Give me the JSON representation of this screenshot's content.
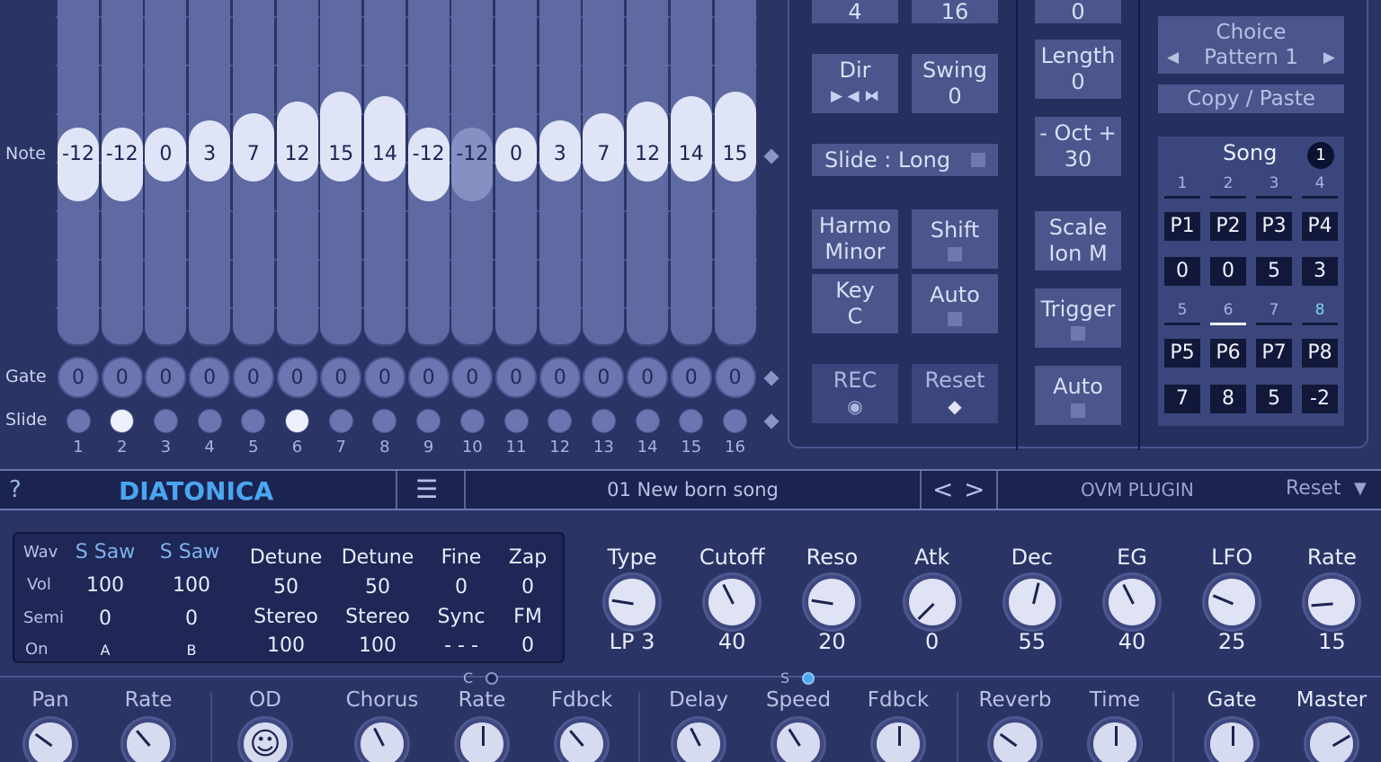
{
  "sequencer": {
    "row_labels": {
      "note": "Note",
      "gate": "Gate",
      "slide": "Slide"
    },
    "note_values": [
      "-12",
      "-12",
      "0",
      "3",
      "7",
      "12",
      "15",
      "14",
      "-12",
      "-12",
      "0",
      "3",
      "7",
      "12",
      "14",
      "15"
    ],
    "note_levels": [
      0.36,
      0.36,
      0.5,
      0.55,
      0.6,
      0.68,
      0.75,
      0.72,
      0.36,
      0.36,
      0.5,
      0.55,
      0.6,
      0.68,
      0.72,
      0.75
    ],
    "note_dim": [
      false,
      false,
      false,
      false,
      false,
      false,
      false,
      false,
      false,
      true,
      false,
      false,
      false,
      false,
      false,
      false
    ],
    "gate_values": [
      "0",
      "0",
      "0",
      "0",
      "0",
      "0",
      "0",
      "0",
      "0",
      "0",
      "0",
      "0",
      "0",
      "0",
      "0",
      "0"
    ],
    "slide_on": [
      false,
      true,
      false,
      false,
      false,
      true,
      false,
      false,
      false,
      false,
      false,
      false,
      false,
      false,
      false,
      false
    ],
    "step_numbers": [
      "1",
      "2",
      "3",
      "4",
      "5",
      "6",
      "7",
      "8",
      "9",
      "10",
      "11",
      "12",
      "13",
      "14",
      "15",
      "16"
    ]
  },
  "controls": {
    "top_val_1": "4",
    "top_val_2": "16",
    "top_val_3": "0",
    "dir_label": "Dir",
    "dir_glyphs": "▶ ◀ ⧓",
    "swing_label": "Swing",
    "swing_value": "0",
    "slide_label": "Slide :",
    "slide_value": "Long",
    "harmo_l1": "Harmo",
    "harmo_l2": "Minor",
    "shift_label": "Shift",
    "key_label": "Key",
    "key_value": "C",
    "auto_label": "Auto",
    "rec_label": "REC",
    "rec_glyph": "◉",
    "reset_label": "Reset",
    "reset_glyph": "◆",
    "length_label": "Length",
    "length_value": "0",
    "oct_label": "- Oct +",
    "oct_value": "30",
    "scale_label": "Scale",
    "scale_value": "Ion M",
    "trigger_label": "Trigger",
    "auto2_label": "Auto"
  },
  "song": {
    "choice_label": "Choice",
    "choice_prev": "◀",
    "choice_value": "Pattern 1",
    "choice_next": "▶",
    "copy_paste": "Copy / Paste",
    "song_label": "Song",
    "song_badge": "1",
    "head1": [
      "1",
      "2",
      "3",
      "4"
    ],
    "row1": [
      "P1",
      "P2",
      "P3",
      "P4"
    ],
    "row2": [
      "0",
      "0",
      "5",
      "3"
    ],
    "head2": [
      "5",
      "6",
      "7",
      "8"
    ],
    "row3": [
      "P5",
      "P6",
      "P7",
      "P8"
    ],
    "row4": [
      "7",
      "8",
      "5",
      "-2"
    ]
  },
  "bar": {
    "help": "?",
    "title": "DIATONICA",
    "menu_glyph": "☰",
    "preset": "01 New born song",
    "prev": "<",
    "next": ">",
    "brand": "OVM PLUGIN",
    "reset": "Reset",
    "reset_arrow": "▼"
  },
  "osc": {
    "wav": "Wav",
    "vol": "Vol",
    "semi": "Semi",
    "on": "On",
    "wave_a": "S Saw",
    "wave_b": "S Saw",
    "vol_a": "100",
    "vol_b": "100",
    "semi_a": "0",
    "semi_b": "0",
    "on_a": "A",
    "on_b": "B",
    "detune1": "Detune",
    "detune1_val": "50",
    "detune2": "Detune",
    "detune2_val": "50",
    "fine": "Fine",
    "fine_val": "0",
    "zap": "Zap",
    "zap_val": "0",
    "stereo1": "Stereo",
    "stereo1_val": "100",
    "stereo2": "Stereo",
    "stereo2_val": "100",
    "sync": "Sync",
    "sync_val": "- - -",
    "fm": "FM",
    "fm_val": "0"
  },
  "synth_knobs": [
    {
      "label": "Type",
      "value": "LP 3",
      "level": 0.2
    },
    {
      "label": "Cutoff",
      "value": "40",
      "level": 0.4
    },
    {
      "label": "Reso",
      "value": "20",
      "level": 0.2
    },
    {
      "label": "Atk",
      "value": "0",
      "level": 0.0
    },
    {
      "label": "Dec",
      "value": "55",
      "level": 0.55
    },
    {
      "label": "EG",
      "value": "40",
      "level": 0.4
    },
    {
      "label": "LFO",
      "value": "25",
      "level": 0.25
    },
    {
      "label": "Rate",
      "value": "15",
      "level": 0.15
    }
  ],
  "fx": {
    "c_label": "C",
    "s_label": "S",
    "labels": [
      "Pan",
      "Rate",
      "OD",
      "Chorus",
      "Rate",
      "Fdbck",
      "Delay",
      "Speed",
      "Fdbck",
      "Reverb",
      "Time",
      "Gate",
      "Master"
    ],
    "levels": [
      0.3,
      0.35,
      0.5,
      0.4,
      0.5,
      0.35,
      0.4,
      0.38,
      0.5,
      0.3,
      0.5,
      0.5,
      0.72
    ],
    "od_glyph": "☺"
  }
}
